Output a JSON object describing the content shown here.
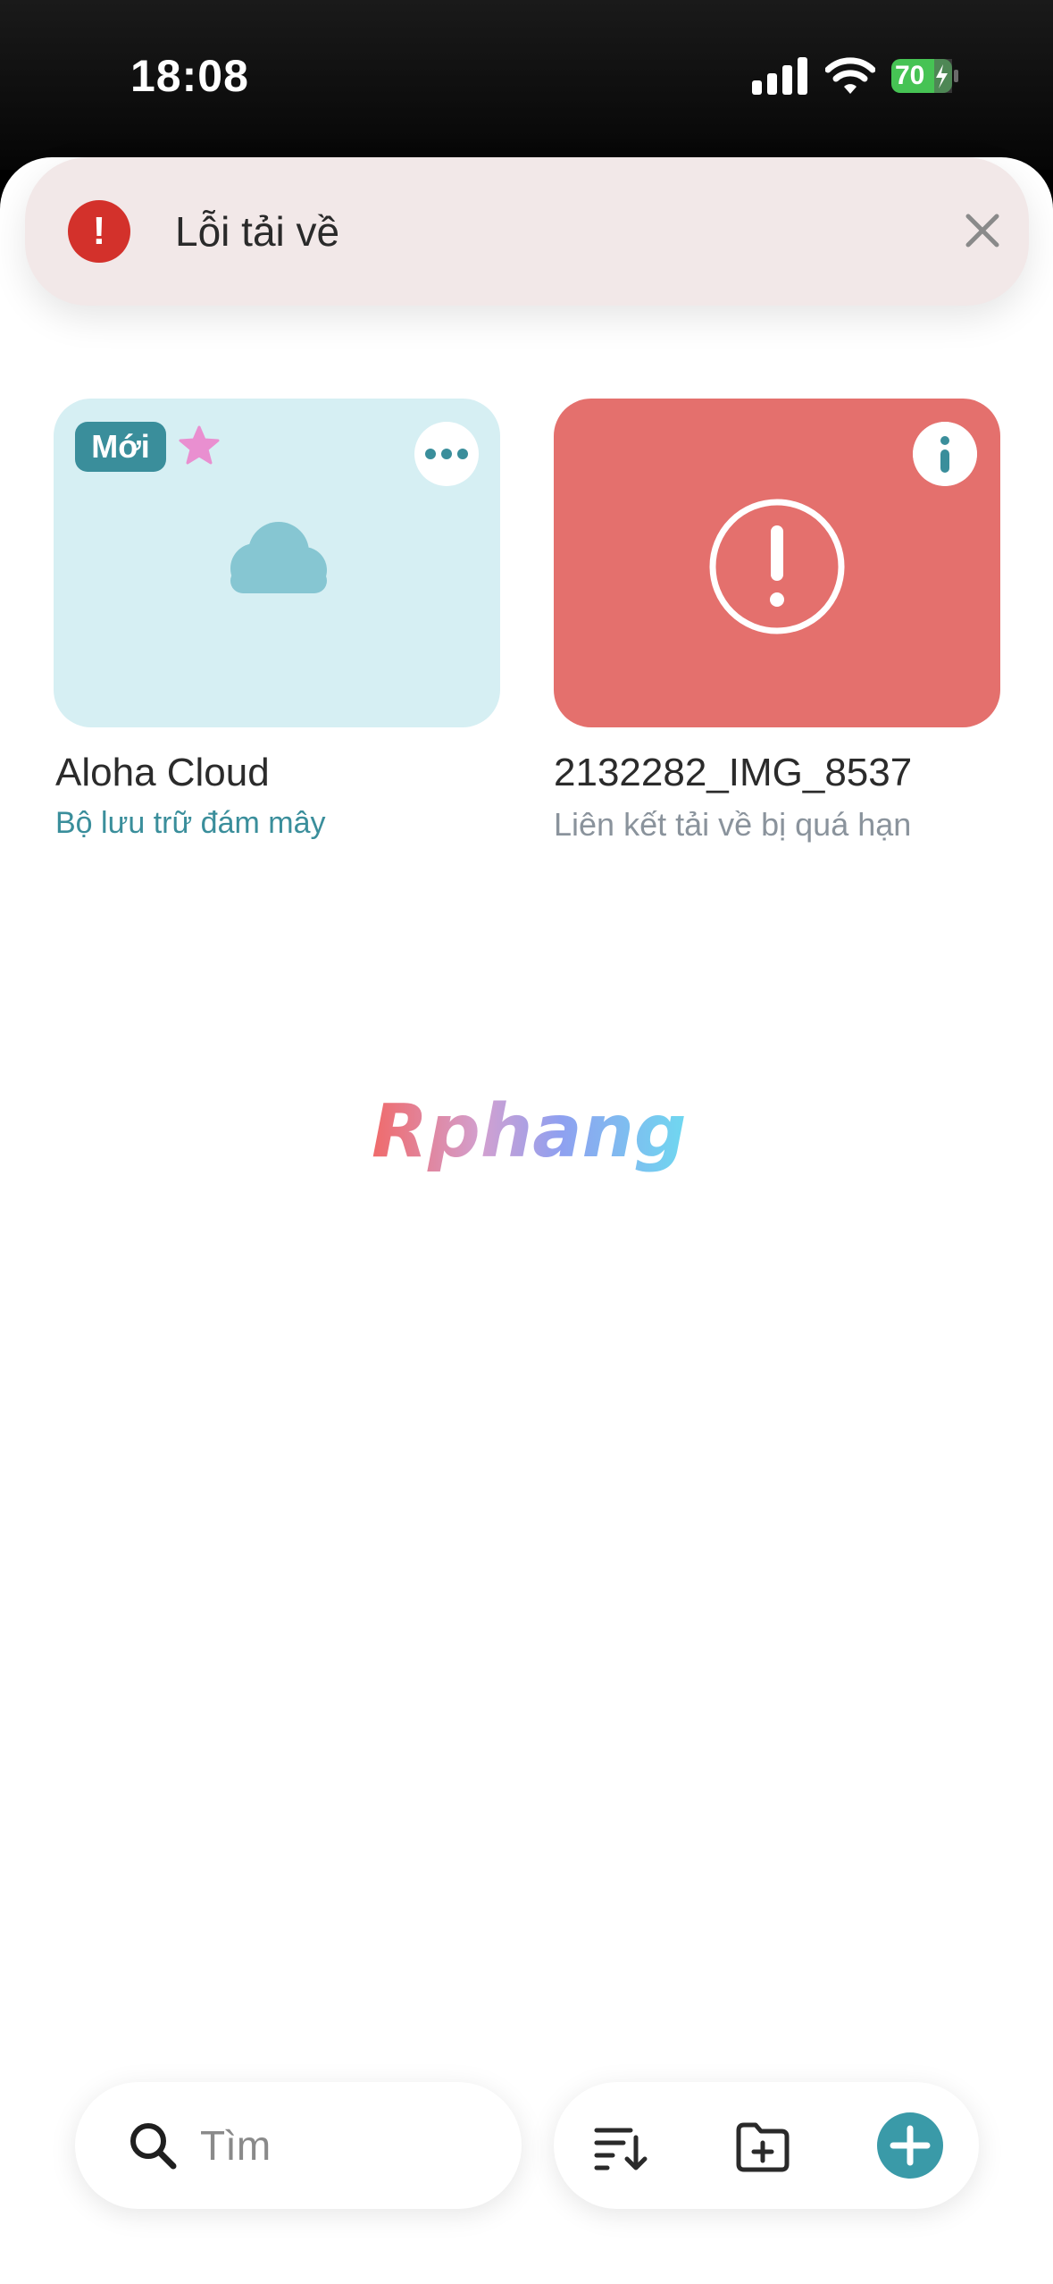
{
  "status_bar": {
    "time": "18:08",
    "battery": "70"
  },
  "toast": {
    "title": "Lỗi tải về"
  },
  "cards": [
    {
      "badge": "Mới",
      "title": "Aloha Cloud",
      "subtitle": "Bộ lưu trữ đám mây",
      "icon": "cloud-icon"
    },
    {
      "title": "2132282_IMG_8537",
      "subtitle": "Liên kết tải về bị quá hạn",
      "icon": "error-icon"
    }
  ],
  "watermark": "Rphang",
  "search": {
    "placeholder": "Tìm"
  },
  "colors": {
    "accent": "#3a9aa8",
    "error": "#e4706d",
    "toast_bg": "#f2e8e8",
    "cloud_card": "#d6eff3"
  }
}
